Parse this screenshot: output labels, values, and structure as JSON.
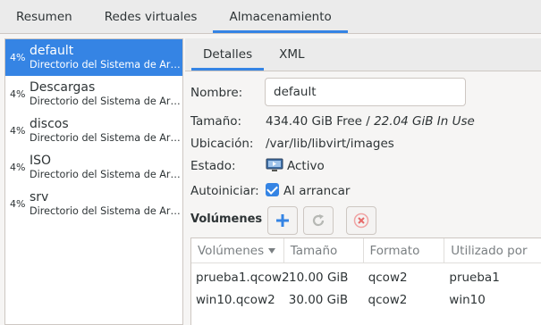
{
  "top_tabs": [
    "Resumen",
    "Redes virtuales",
    "Almacenamiento"
  ],
  "pools": [
    {
      "pct": "4%",
      "name": "default",
      "desc": "Directorio del Sistema de Ar…"
    },
    {
      "pct": "4%",
      "name": "Descargas",
      "desc": "Directorio del Sistema de Ar…"
    },
    {
      "pct": "4%",
      "name": "discos",
      "desc": "Directorio del Sistema de Ar…"
    },
    {
      "pct": "4%",
      "name": "ISO",
      "desc": "Directorio del Sistema de Ar…"
    },
    {
      "pct": "4%",
      "name": "srv",
      "desc": "Directorio del Sistema de Ar…"
    }
  ],
  "inner_tabs": [
    "Detalles",
    "XML"
  ],
  "details": {
    "name_label": "Nombre:",
    "name_value": "default",
    "size_label": "Tamaño:",
    "size_free": "434.40 GiB Free /",
    "size_used": "22.04 GiB In Use",
    "location_label": "Ubicación:",
    "location_value": "/var/lib/libvirt/images",
    "state_label": "Estado:",
    "state_value": "Activo",
    "autostart_label": "Autoiniciar:",
    "autostart_value": "Al arrancar"
  },
  "volumes": {
    "heading": "Volúmenes",
    "columns": [
      "Volúmenes",
      "Tamaño",
      "Formato",
      "Utilizado por"
    ],
    "rows": [
      [
        "prueba1.qcow2",
        "10.00 GiB",
        "qcow2",
        "prueba1"
      ],
      [
        "win10.qcow2",
        "30.00 GiB",
        "qcow2",
        "win10"
      ]
    ]
  },
  "colors": {
    "accent": "#3584e4",
    "delete": "#e01b24"
  }
}
